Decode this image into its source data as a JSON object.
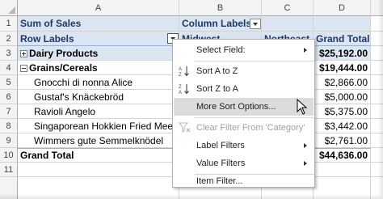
{
  "columns": [
    "A",
    "B",
    "C",
    "D"
  ],
  "row_numbers": [
    "1",
    "2",
    "3",
    "4",
    "5",
    "6",
    "7",
    "8",
    "9",
    "10",
    "11"
  ],
  "pivot": {
    "row1": {
      "sum_of_sales": "Sum of Sales",
      "column_labels": "Column Labels"
    },
    "row2": {
      "row_labels": "Row Labels",
      "midwest": "Midwest",
      "northeast": "Northeast",
      "grand_total": "Grand Total"
    },
    "dairy": {
      "label": "Dairy Products",
      "total": "$25,192.00"
    },
    "grains": {
      "label": "Grains/Cereals",
      "total": "$19,444.00"
    },
    "items": [
      {
        "label": "Gnocchi di nonna Alice",
        "total": "$2,866.00"
      },
      {
        "label": "Gustaf's Knäckebröd",
        "total": "$5,000.00"
      },
      {
        "label": "Ravioli Angelo",
        "total": "$5,375.00"
      },
      {
        "label": "Singaporean Hokkien Fried Mee",
        "total": "$3,442.00"
      },
      {
        "label": "Wimmers gute Semmelknödel",
        "total": "$2,761.00"
      }
    ],
    "grand_total_row": {
      "label": "Grand Total",
      "total": "$44,636.00"
    }
  },
  "menu": {
    "select_field": "Select Field:",
    "sort_az": "Sort A to Z",
    "sort_za": "Sort Z to A",
    "more_sort": "More Sort Options...",
    "clear_filter": "Clear Filter From 'Category'",
    "label_filters": "Label Filters",
    "value_filters": "Value Filters",
    "item_filter": "Item Filter..."
  },
  "icons": {
    "sort_az": "sort-ascending-icon",
    "sort_za": "sort-descending-icon",
    "clear": "clear-filter-icon"
  },
  "colors": {
    "header_band": "#dbe5f1",
    "header_text": "#1f3864",
    "menu_hover": "#dcdcdc"
  }
}
